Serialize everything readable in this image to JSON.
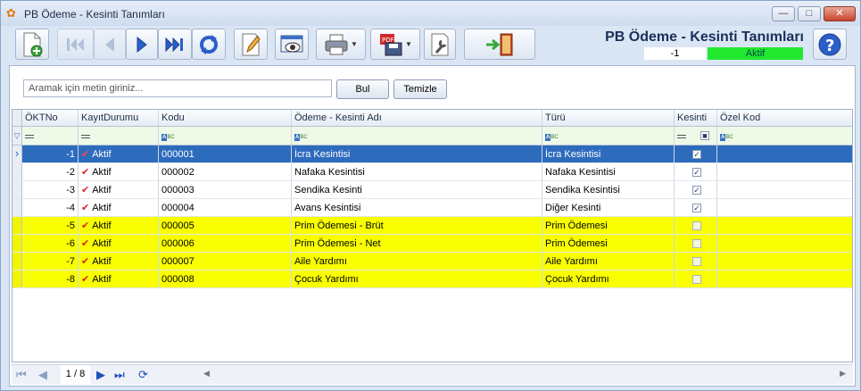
{
  "window": {
    "title": "PB Ödeme - Kesinti Tanımları",
    "icon": "butterfly-icon"
  },
  "header": {
    "title": "PB Ödeme - Kesinti Tanımları",
    "record_value": "-1",
    "record_status": "Aktif",
    "status_color": "#22e830"
  },
  "search": {
    "placeholder": "Aramak için metin giriniz...",
    "find_label": "Bul",
    "clear_label": "Temizle"
  },
  "grid": {
    "columns": [
      "ÖKTNo",
      "KayıtDurumu",
      "Kodu",
      "Ödeme - Kesinti Adı",
      "Türü",
      "Kesinti",
      "Özel Kod"
    ],
    "rows": [
      {
        "no": "-1",
        "status": "Aktif",
        "code": "000001",
        "name": "İcra Kesintisi",
        "type": "İcra Kesintisi",
        "kesinti": true
      },
      {
        "no": "-2",
        "status": "Aktif",
        "code": "000002",
        "name": "Nafaka Kesintisi",
        "type": "Nafaka Kesintisi",
        "kesinti": true
      },
      {
        "no": "-3",
        "status": "Aktif",
        "code": "000003",
        "name": "Sendika Kesinti",
        "type": "Sendika Kesintisi",
        "kesinti": true
      },
      {
        "no": "-4",
        "status": "Aktif",
        "code": "000004",
        "name": "Avans Kesintisi",
        "type": "Diğer Kesinti",
        "kesinti": true
      },
      {
        "no": "-5",
        "status": "Aktif",
        "code": "000005",
        "name": "Prim Ödemesi - Brüt",
        "type": "Prim Ödemesi",
        "kesinti": false
      },
      {
        "no": "-6",
        "status": "Aktif",
        "code": "000006",
        "name": "Prim Ödemesi - Net",
        "type": "Prim Ödemesi",
        "kesinti": false
      },
      {
        "no": "-7",
        "status": "Aktif",
        "code": "000007",
        "name": "Aile Yardımı",
        "type": "Aile Yardımı",
        "kesinti": false
      },
      {
        "no": "-8",
        "status": "Aktif",
        "code": "000008",
        "name": "Çocuk Yardımı",
        "type": "Çocuk Yardımı",
        "kesinti": false
      }
    ],
    "highlight_color": "#f9ff00",
    "selected_color": "#2d6bbd"
  },
  "pager": {
    "position": "1 / 8"
  }
}
